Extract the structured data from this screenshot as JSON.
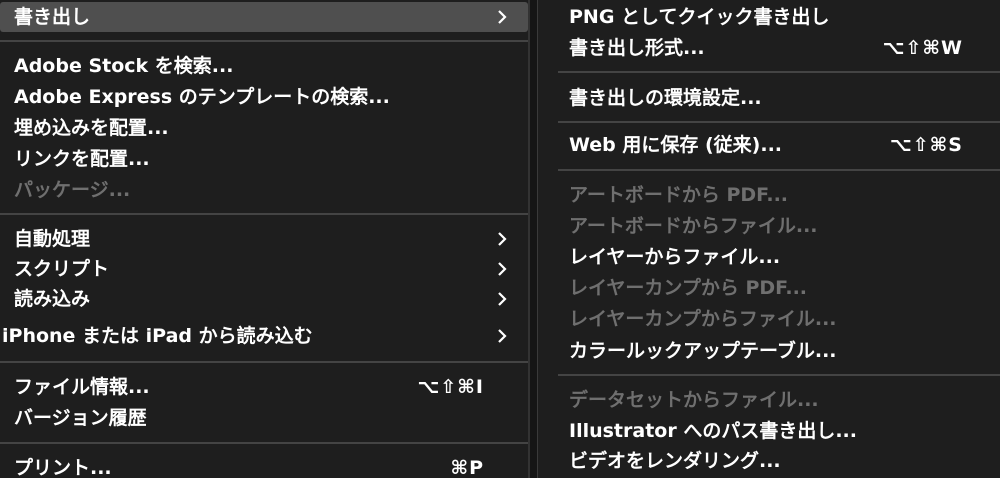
{
  "left_menu": {
    "items": [
      {
        "label": "書き出し",
        "submenu": true,
        "highlighted": true
      },
      {
        "label": "Adobe Stock を検索..."
      },
      {
        "label": "Adobe Express のテンプレートの検索..."
      },
      {
        "label": "埋め込みを配置..."
      },
      {
        "label": "リンクを配置..."
      },
      {
        "label": "パッケージ...",
        "disabled": true
      },
      {
        "label": "自動処理",
        "submenu": true
      },
      {
        "label": "スクリプト",
        "submenu": true
      },
      {
        "label": "読み込み",
        "submenu": true
      },
      {
        "label": "iPhone または iPad から読み込む",
        "submenu": true
      },
      {
        "label": "ファイル情報...",
        "shortcut": "⌥⇧⌘I"
      },
      {
        "label": "バージョン履歴"
      },
      {
        "label": "プリント...",
        "shortcut": "⌘P"
      }
    ]
  },
  "right_menu": {
    "items": [
      {
        "label": "PNG としてクイック書き出し"
      },
      {
        "label": "書き出し形式...",
        "shortcut": "⌥⇧⌘W"
      },
      {
        "label": "書き出しの環境設定..."
      },
      {
        "label": "Web 用に保存 (従来)...",
        "shortcut": "⌥⇧⌘S"
      },
      {
        "label": "アートボードから PDF...",
        "disabled": true
      },
      {
        "label": "アートボードからファイル...",
        "disabled": true
      },
      {
        "label": "レイヤーからファイル..."
      },
      {
        "label": "レイヤーカンプから PDF...",
        "disabled": true
      },
      {
        "label": "レイヤーカンプからファイル...",
        "disabled": true
      },
      {
        "label": "カラールックアップテーブル..."
      },
      {
        "label": "データセットからファイル...",
        "disabled": true
      },
      {
        "label": "Illustrator へのパス書き出し..."
      },
      {
        "label": "ビデオをレンダリング..."
      }
    ]
  },
  "colors": {
    "background": "#1e1e1e",
    "text": "#ffffff",
    "disabled_text": "#6f6f6f",
    "highlight": "#4f4f4f",
    "separator": "#444444"
  }
}
